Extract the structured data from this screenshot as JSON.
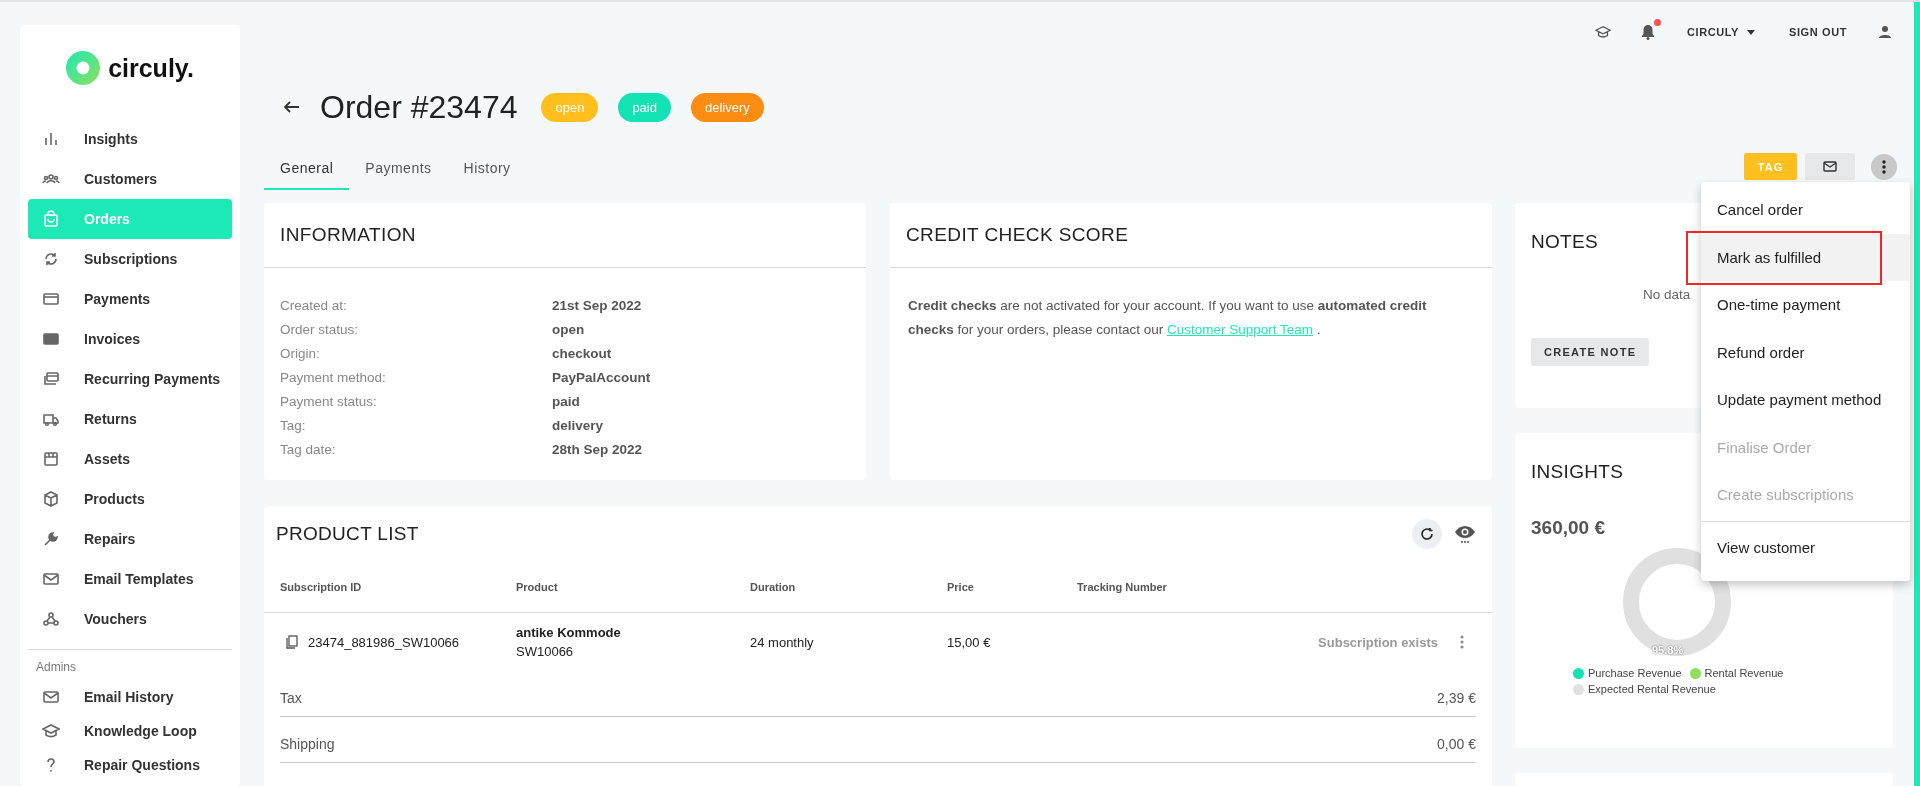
{
  "top_bar": {
    "notifications_unread": true,
    "account": "CIRCULY",
    "sign_out": "SIGN OUT"
  },
  "sidebar": {
    "logo": "circuly.",
    "items": [
      {
        "label": "Insights",
        "selected": false
      },
      {
        "label": "Customers",
        "selected": false
      },
      {
        "label": "Orders",
        "selected": true
      },
      {
        "label": "Subscriptions",
        "selected": false
      },
      {
        "label": "Payments",
        "selected": false
      },
      {
        "label": "Invoices",
        "selected": false
      },
      {
        "label": "Recurring Payments",
        "selected": false
      },
      {
        "label": "Returns",
        "selected": false
      },
      {
        "label": "Assets",
        "selected": false
      },
      {
        "label": "Products",
        "selected": false
      },
      {
        "label": "Repairs",
        "selected": false
      },
      {
        "label": "Email Templates",
        "selected": false
      },
      {
        "label": "Vouchers",
        "selected": false
      }
    ],
    "section": "Admins",
    "admin_items": [
      {
        "label": "Email History",
        "selected": false
      },
      {
        "label": "Knowledge Loop",
        "selected": false
      },
      {
        "label": "Repair Questions",
        "selected": false
      }
    ]
  },
  "order": {
    "title": "Order #23474",
    "badges": [
      {
        "label": "open",
        "color": "#ffc01f"
      },
      {
        "label": "paid",
        "color": "#13e3b4"
      },
      {
        "label": "delivery",
        "color": "#fb8c12"
      }
    ]
  },
  "tabs": [
    {
      "label": "General",
      "selected": true
    },
    {
      "label": "Payments",
      "selected": false
    },
    {
      "label": "History",
      "selected": false
    }
  ],
  "actions": {
    "tag": "TAG"
  },
  "information": {
    "title": "INFORMATION",
    "rows": [
      {
        "label": "Created at:",
        "value": "21st Sep 2022"
      },
      {
        "label": "Order status:",
        "value": "open"
      },
      {
        "label": "Origin:",
        "value": "checkout"
      },
      {
        "label": "Payment method:",
        "value": "PayPalAccount"
      },
      {
        "label": "Payment status:",
        "value": "paid"
      },
      {
        "label": "Tag:",
        "value": "delivery"
      },
      {
        "label": "Tag date:",
        "value": "28th Sep 2022"
      }
    ]
  },
  "credit_check": {
    "title": "CREDIT CHECK SCORE",
    "text": "**Credit checks** are not activated for your account. If you want to use **automated credit checks** for your orders, please contact our",
    "link": "Customer Support Team",
    "after_link": "."
  },
  "product_list": {
    "title": "PRODUCT LIST",
    "columns": [
      "Subscription ID",
      "Product",
      "Duration",
      "Price",
      "Tracking Number"
    ],
    "rows": [
      {
        "subscription_id": "23474_881986_SW10066",
        "product": "antike Kommode",
        "sku": "SW10066",
        "duration": "24 monthly",
        "price": "15,00 €",
        "status": "Subscription exists"
      }
    ],
    "totals": [
      {
        "label": "Tax",
        "value": "2,39 €"
      },
      {
        "label": "Shipping",
        "value": "0,00 €"
      }
    ]
  },
  "notes": {
    "title": "NOTES",
    "empty_text": "No data",
    "button": "CREATE NOTE"
  },
  "insights": {
    "title": "INSIGHTS",
    "amount": "360,00 €",
    "donut_label": "95.8%",
    "legend": [
      {
        "label": "Purchase Revenue",
        "color": "#13e3b4"
      },
      {
        "label": "Rental Revenue",
        "color": "#8ee05a"
      },
      {
        "label": "Expected Rental Revenue",
        "color": "#e0e0e0"
      }
    ]
  },
  "menu": {
    "groups": [
      [
        {
          "label": "Cancel order",
          "selected": false,
          "disabled": false,
          "outlined": false
        },
        {
          "label": "Mark as fulfilled",
          "selected": true,
          "disabled": false,
          "outlined": true
        },
        {
          "label": "One-time payment",
          "selected": false,
          "disabled": false,
          "outlined": false
        },
        {
          "label": "Refund order",
          "selected": false,
          "disabled": false,
          "outlined": false
        },
        {
          "label": "Update payment method",
          "selected": false,
          "disabled": false,
          "outlined": false
        },
        {
          "label": "Finalise Order",
          "selected": false,
          "disabled": true,
          "outlined": false
        },
        {
          "label": "Create subscriptions",
          "selected": false,
          "disabled": true,
          "outlined": false
        }
      ],
      [
        {
          "label": "View customer",
          "selected": false,
          "disabled": false,
          "outlined": false
        }
      ]
    ]
  }
}
